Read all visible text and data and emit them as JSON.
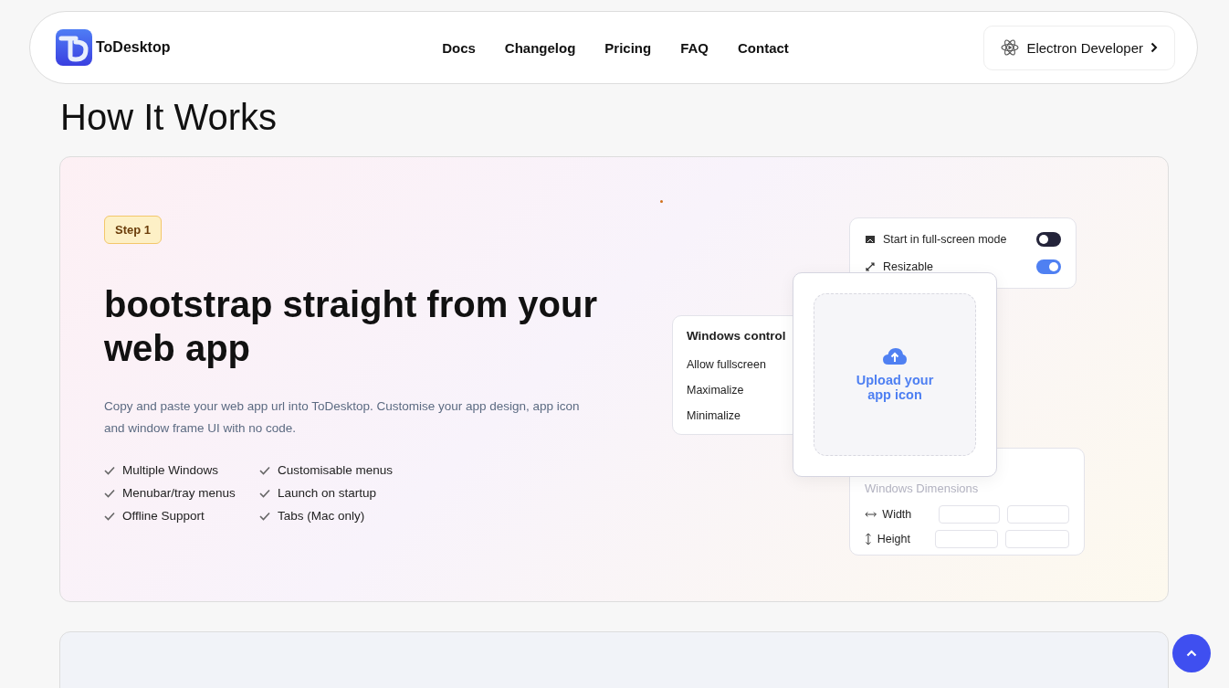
{
  "nav": {
    "brand": "ToDesktop",
    "links": [
      "Docs",
      "Changelog",
      "Pricing",
      "FAQ",
      "Contact"
    ],
    "cta": "Electron Developer"
  },
  "heading": "How It Works",
  "step": {
    "badge": "Step 1",
    "title": "bootstrap straight from your web app",
    "description": "Copy and paste your web app url into ToDesktop. Customise your app design, app icon and window frame UI with no code.",
    "features": [
      "Multiple Windows",
      "Customisable menus",
      "Menubar/tray menus",
      "Launch on startup",
      "Offline Support",
      "Tabs (Mac only)"
    ]
  },
  "settings": [
    {
      "kind": "screen",
      "label": "Start in full-screen mode",
      "on": false
    },
    {
      "kind": "resize",
      "label": "Resizable",
      "on": true
    }
  ],
  "controls": {
    "title": "Windows control",
    "items": [
      "Allow fullscreen",
      "Maximalize",
      "Minimalize"
    ]
  },
  "upload": {
    "label": "Upload your app icon"
  },
  "dimensions": {
    "title": "Windows Dimensions",
    "rows": [
      {
        "kind": "horizontal",
        "label": "Width"
      },
      {
        "kind": "vertical",
        "label": "Height"
      }
    ]
  }
}
